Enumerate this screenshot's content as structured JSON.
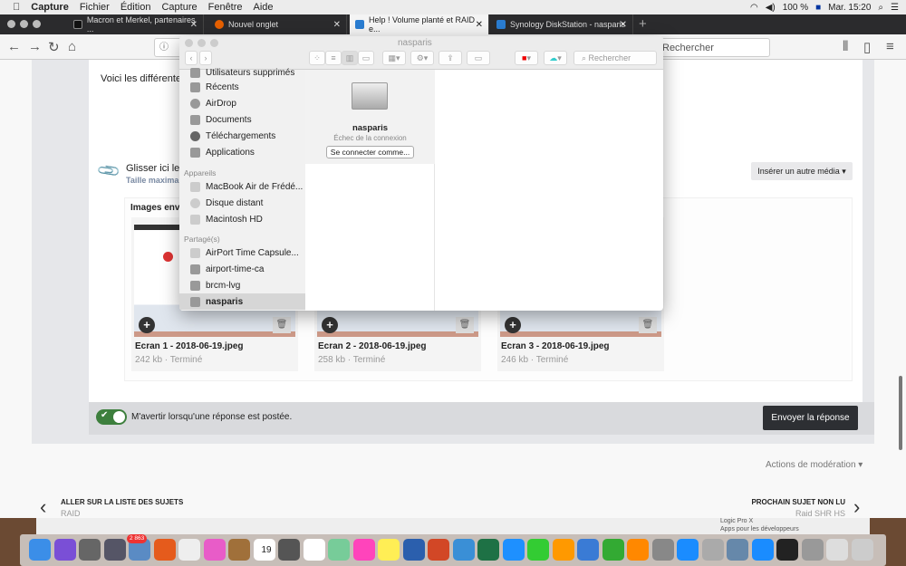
{
  "menubar": {
    "app": "Capture",
    "items": [
      "Fichier",
      "Édition",
      "Capture",
      "Fenêtre",
      "Aide"
    ],
    "battery": "100 %",
    "clock": "Mar. 15:20"
  },
  "browser": {
    "tabs": [
      {
        "title": "Macron et Merkel, partenaires ...",
        "favicon_color": "#111"
      },
      {
        "title": "Nouvel onglet",
        "favicon_color": "#e66000"
      },
      {
        "title": "Help ! Volume planté et RAID e...",
        "favicon_color": "#2a7dd1",
        "active": true
      },
      {
        "title": "Synology DiskStation - nasparis",
        "favicon_color": "#2a7dd1"
      }
    ],
    "new_tab": "+",
    "search_placeholder": "Rechercher"
  },
  "page": {
    "intro_text": "Voici les différentes",
    "drop_text": "Glisser ici les",
    "max_size_text": "Taille maximal",
    "insert_media": "Insérer un autre média ▾",
    "images_heading": "Images envo",
    "images": [
      {
        "name": "Ecran 1 - 2018-06-19.jpeg",
        "meta": "242 kb · Terminé"
      },
      {
        "name": "Ecran 2 - 2018-06-19.jpeg",
        "meta": "258 kb · Terminé"
      },
      {
        "name": "Ecran 3 - 2018-06-19.jpeg",
        "meta": "246 kb · Terminé"
      }
    ],
    "notify_label": "M'avertir lorsqu'une réponse est postée.",
    "notify_on": true,
    "send_button": "Envoyer la réponse",
    "moderation": "Actions de modération ▾",
    "prev": {
      "label": "ALLER SUR LA LISTE DES SUJETS",
      "sub": "RAID"
    },
    "next": {
      "label": "PROCHAIN SUJET NON LU",
      "sub": "Raid SHR HS"
    }
  },
  "finder": {
    "title": "nasparis",
    "search_placeholder": "Rechercher",
    "sidebar": {
      "favorites": [
        "Utilisateurs supprimés",
        "Récents",
        "AirDrop",
        "Documents",
        "Téléchargements",
        "Applications"
      ],
      "devices_header": "Appareils",
      "devices": [
        "MacBook Air de Frédé...",
        "Disque distant",
        "Macintosh HD"
      ],
      "shared_header": "Partagé(s)",
      "shared": [
        "AirPort Time Capsule...",
        "airport-time-ca",
        "brcm-lvg",
        "nasparis"
      ],
      "selected": "nasparis"
    },
    "server_name": "nasparis",
    "status": "Échec de la connexion",
    "connect_button": "Se connecter comme..."
  },
  "behind_window": {
    "items": [
      "Logic Pro X",
      "Apps pour les développeurs"
    ]
  },
  "dock": {
    "apps": [
      "Finder",
      "Siri",
      "System Preferences",
      "Launchpad",
      "Mail",
      "Firefox",
      "Notes",
      "iTunes",
      "Notebook",
      "Calendar",
      "Calculator",
      "Reminders",
      "Maps",
      "Photos",
      "Stickies",
      "Word",
      "PowerPoint",
      "Vectorworks",
      "Excel",
      "Messenger",
      "FaceTime",
      "Pages",
      "Keynote",
      "Numbers",
      "iBooks",
      "Logic",
      "App Store",
      "Xcode",
      "Preview",
      "Safari",
      "Terminal",
      "Utilities",
      "Document",
      "Trash"
    ],
    "calendar_day": "19",
    "mail_badge": "2 863"
  }
}
